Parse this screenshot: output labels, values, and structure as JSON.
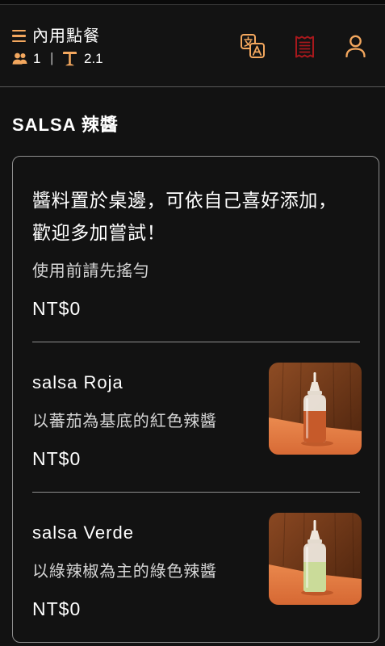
{
  "header": {
    "title": "內用點餐",
    "guest_count": "1",
    "separator": "|",
    "table_number": "2.1",
    "icons": {
      "menu": "hamburger-menu-icon",
      "guests": "people-icon",
      "table": "table-icon",
      "translate": "translate-icon",
      "orders": "receipt-icon",
      "account": "user-icon"
    }
  },
  "category": {
    "heading": "SALSA 辣醬",
    "intro_lines": [
      "醬料置於桌邊，可依自己喜好添加，",
      "歡迎多加嘗試！"
    ],
    "note": "使用前請先搖勻",
    "price": "NT$0"
  },
  "items": [
    {
      "name": "salsa Roja",
      "description": "以蕃茄為基底的紅色辣醬",
      "price": "NT$0",
      "sauce_color": "#c65a2a"
    },
    {
      "name": "salsa Verde",
      "description": "以綠辣椒為主的綠色辣醬",
      "price": "NT$0",
      "sauce_color": "#cadb99"
    }
  ],
  "colors": {
    "background": "#121212",
    "accent": "#f3a75e",
    "receipt": "#a8181c",
    "text": "#ffffff",
    "muted_text": "#d4d4d4",
    "border": "#8e8e8e"
  }
}
